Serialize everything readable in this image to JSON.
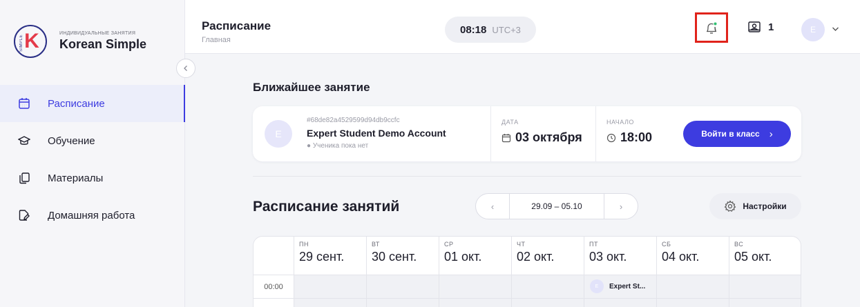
{
  "brand": {
    "subtitle": "ИНДИВИДУАЛЬНЫЕ ЗАНЯТИЯ",
    "name": "Korean Simple",
    "logo_letter": "K",
    "logo_side_text": "SIMPLE",
    "logo_colors": {
      "ring": "#2a2f86",
      "letter": "#e43a4a"
    }
  },
  "sidebar": {
    "collapse_icon": "chevron-left-icon",
    "items": [
      {
        "label": "Расписание",
        "icon": "calendar-icon",
        "active": true
      },
      {
        "label": "Обучение",
        "icon": "graduation-cap-icon",
        "active": false
      },
      {
        "label": "Материалы",
        "icon": "copy-files-icon",
        "active": false
      },
      {
        "label": "Домашняя работа",
        "icon": "document-edit-icon",
        "active": false
      }
    ]
  },
  "header": {
    "title": "Расписание",
    "breadcrumb": "Главная",
    "time": "08:18",
    "timezone": "UTC+3",
    "notification_icon": "bell-icon",
    "notification_dot_color": "#2fbf71",
    "students_icon": "student-board-icon",
    "students_count": "1",
    "user_avatar_letter": "E"
  },
  "upcoming": {
    "section_title": "Ближайшее занятие",
    "avatar_letter": "E",
    "lesson_id": "#68de82a4529599d94db9ccfc",
    "student_name": "Expert Student Demo Account",
    "note": "● Ученика пока нет",
    "date_label": "ДАТА",
    "date_value": "03 октября",
    "start_label": "НАЧАЛО",
    "start_value": "18:00",
    "enter_button": "Войти в класс",
    "enter_arrow": "›"
  },
  "schedule": {
    "title": "Расписание занятий",
    "prev": "‹",
    "range": "29.09 – 05.10",
    "next": "›",
    "settings_label": "Настройки",
    "days": [
      {
        "weekday": "ПН",
        "date": "29 сент."
      },
      {
        "weekday": "ВТ",
        "date": "30 сент."
      },
      {
        "weekday": "СР",
        "date": "01 окт."
      },
      {
        "weekday": "ЧТ",
        "date": "02 окт."
      },
      {
        "weekday": "ПТ",
        "date": "03 окт."
      },
      {
        "weekday": "СБ",
        "date": "04 окт."
      },
      {
        "weekday": "ВС",
        "date": "05 окт."
      }
    ],
    "rows": [
      {
        "time": "00:00",
        "event": {
          "day_index": 4,
          "avatar": "E",
          "label": "Expert St..."
        }
      }
    ]
  },
  "colors": {
    "accent": "#3d3ce0",
    "highlight_border": "#e0231b"
  }
}
